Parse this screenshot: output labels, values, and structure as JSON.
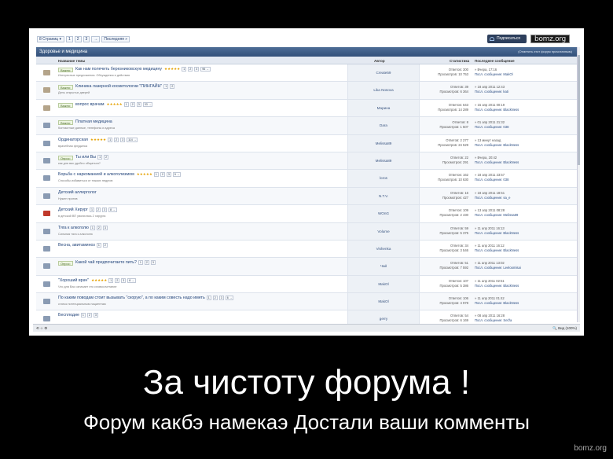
{
  "topbar": {
    "page_dropdown": "8 Страниц",
    "pages": [
      "1",
      "2",
      "3",
      "→",
      "Последняя »"
    ],
    "subscribe": "Подписаться",
    "watermark": "bomz.org"
  },
  "forum": {
    "title": "Здоровье и медицина",
    "mark_read": "(Отметить этот форум прочитанным)",
    "columns": {
      "topic": "Название темы",
      "author": "Автор",
      "stats": "Статистика",
      "last": "Последнее сообщение"
    }
  },
  "rows": [
    {
      "tag": "Важно:",
      "title": "Как нам полечить березниковскую медицину",
      "stars": "★★★★★",
      "pages": [
        "1",
        "2",
        "3",
        "96 →"
      ],
      "sub": "Интересные предложения. Обсуждения и действия",
      "author": "Create59",
      "replies": "Ответов: 300",
      "views": "Просмотров: 10 753",
      "last_time": "Вчера, 17:16",
      "last_author": "Посл. сообщение: MakOl",
      "icon": "pin"
    },
    {
      "tag": "Важно:",
      "title": "Клиника лазерной косметологии \"ПИНГАЙН\"",
      "stars": "",
      "pages": [
        "1",
        "2"
      ],
      "sub": "День открытых дверей",
      "author": "Lika Nosova",
      "replies": "Ответов: 39",
      "views": "Просмотров: 6 364",
      "last_time": "18 апр 2011 12:43",
      "last_author": "Посл. сообщение: kati",
      "icon": "pin"
    },
    {
      "tag": "Важно:",
      "title": "вопрос врачам",
      "stars": "★★★★★",
      "pages": [
        "1",
        "2",
        "3",
        "33 →"
      ],
      "sub": "",
      "author": "Марина",
      "replies": "Ответов: 643",
      "views": "Просмотров: 14 289",
      "last_time": "15 апр 2011 00:19",
      "last_author": "Посл. сообщение: BlackNess",
      "icon": "pin"
    },
    {
      "tag": "Важно:",
      "title": "Платная медицина",
      "stars": "",
      "pages": [],
      "sub": "Контактные данные, телефоны и адреса",
      "author": "Dara",
      "replies": "Ответов: 8",
      "views": "Просмотров: 1 507",
      "last_time": "01 апр 2011 21:32",
      "last_author": "Посл. сообщение: 038",
      "icon": "normal"
    },
    {
      "tag": "",
      "title": "Ординаторская",
      "stars": "★★★★★",
      "pages": [
        "1",
        "2",
        "3",
        "114 →"
      ],
      "sub": "врачебная флудилка",
      "author": "Melissa89",
      "replies": "Ответов: 2 277",
      "views": "Просмотров: 24 529",
      "last_time": "13 минут назад",
      "last_author": "Посл. сообщение: BlackNess",
      "icon": "normal"
    },
    {
      "tag": "Опрос:",
      "title": "Ты или Вы",
      "stars": "",
      "pages": [
        "1",
        "2"
      ],
      "sub": "как для вас удобно общаться?",
      "author": "Melissa89",
      "replies": "Ответов: 22",
      "views": "Просмотров: 291",
      "last_time": "Вчера, 20:42",
      "last_author": "Посл. сообщение: BlackNess",
      "icon": "normal"
    },
    {
      "tag": "",
      "title": "Борьба с наркоманией и алкоголизмом",
      "stars": "★★★★★",
      "pages": [
        "1",
        "2",
        "3",
        "9 →"
      ],
      "sub": "Способы избавиться от тяжких недугов",
      "author": "loros",
      "replies": "Ответов: 162",
      "views": "Просмотров: 10 630",
      "last_time": "18 апр 2011 23:57",
      "last_author": "Посл. сообщение: 038",
      "icon": "normal"
    },
    {
      "tag": "",
      "title": "Детский аллерголог",
      "stars": "",
      "pages": [],
      "sub": "Нужен против",
      "author": "N.T.V.",
      "replies": "Ответов: 16",
      "views": "Просмотров: 427",
      "last_time": "18 апр 2011 18:51",
      "last_author": "Посл. сообщение: sa_e",
      "icon": "normal"
    },
    {
      "tag": "",
      "title": "Детский Хирург",
      "stars": "",
      "pages": [
        "1",
        "2",
        "3",
        "8 →"
      ],
      "sub": "в детской ВП уволилась 2 хирурга",
      "author": "WOnG",
      "replies": "Ответов: 109",
      "views": "Просмотров: 2 430",
      "last_time": "13 апр 2011 08:28",
      "last_author": "Посл. сообщение: Melissa89",
      "icon": "hot"
    },
    {
      "tag": "",
      "title": "Тяга к алкоголю",
      "stars": "",
      "pages": [
        "1",
        "2",
        "3"
      ],
      "sub": "Сильная тяга к алкоголю",
      "author": "Volume",
      "replies": "Ответов: 59",
      "views": "Просмотров: 5 375",
      "last_time": "11 апр 2011 16:13",
      "last_author": "Посл. сообщение: BlackNess",
      "icon": "normal"
    },
    {
      "tag": "",
      "title": "Весна, авитаминоз",
      "stars": "",
      "pages": [
        "1",
        "2"
      ],
      "sub": "",
      "author": "Vishenka",
      "replies": "Ответов: 34",
      "views": "Просмотров: 3 546",
      "last_time": "11 апр 2011 16:12",
      "last_author": "Посл. сообщение: BlackNess",
      "icon": "normal"
    },
    {
      "tag": "Опрос:",
      "title": "Какой чай предпочитаете пить?",
      "stars": "",
      "pages": [
        "1",
        "2",
        "3"
      ],
      "sub": "",
      "author": "Чай",
      "replies": "Ответов: 51",
      "views": "Просмотров: 7 592",
      "last_time": "11 апр 2011 13:02",
      "last_author": "Посл. сообщение: Leeloomisai",
      "icon": "normal"
    },
    {
      "tag": "",
      "title": "\"Хороший врач\"",
      "stars": "★★★★★",
      "pages": [
        "1",
        "2",
        "3",
        "8 →"
      ],
      "sub": "Что для Вас означает это словосочетание",
      "author": "MakOl",
      "replies": "Ответов: 107",
      "views": "Просмотров: 5 386",
      "last_time": "11 апр 2011 02:51",
      "last_author": "Посл. сообщение: BlackNess",
      "icon": "normal"
    },
    {
      "tag": "",
      "title": "По каким поводам стоит вызывать \"скорую\", а по каким совесть надо иметь",
      "stars": "",
      "pages": [
        "1",
        "2",
        "3",
        "6 →"
      ],
      "sub": "статья потенциальным пациентам",
      "author": "MakOl",
      "replies": "Ответов: 106",
      "views": "Просмотров: 4 978",
      "last_time": "11 апр 2011 01:42",
      "last_author": "Посл. сообщение: BlackNess",
      "icon": "normal"
    },
    {
      "tag": "",
      "title": "Бесплодие",
      "stars": "",
      "pages": [
        "1",
        "2",
        "3"
      ],
      "sub": "",
      "author": "gerry",
      "replies": "Ответов: 54",
      "views": "Просмотров: 6 169",
      "last_time": "08 апр 2011 16:28",
      "last_author": "Посл. сообщение: Serža",
      "icon": "normal"
    }
  ],
  "statusbar": {
    "left": "⟲ ☆ ⚙",
    "right": "🔍 Вид (100%)"
  },
  "caption": "За чистоту форума !",
  "subcaption": "Форум какбэ намекаэ Достали ваши комменты",
  "site": "bomz.org"
}
